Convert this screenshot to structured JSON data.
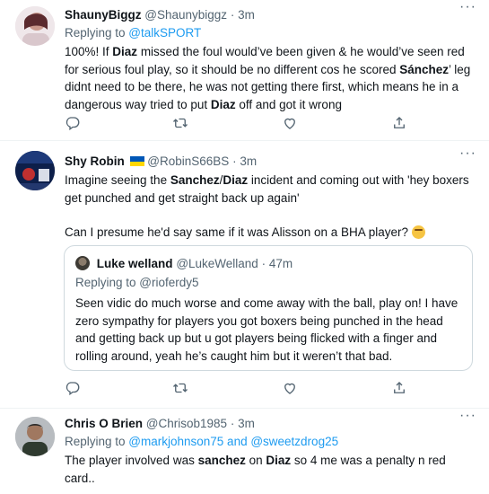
{
  "tweets": [
    {
      "name": "ShaunyBiggz",
      "handle": "@Shaunybiggz",
      "time": "3m",
      "replying_prefix": "Replying to ",
      "replying_to": "@talkSPORT",
      "text": [
        [
          "100%! If ",
          {
            "b": "Diaz"
          },
          " missed the foul would’ve been given & he would’ve seen red for serious foul play, so it should be no different cos he scored ",
          {
            "b": "Sánchez"
          },
          "’ leg didnt need to be there, he was not getting there first, which means he in a dangerous way tried to put ",
          {
            "b": "Diaz"
          },
          " off and got it wrong"
        ]
      ]
    },
    {
      "name": "Shy Robin",
      "handle": "@RobinS66BS",
      "time": "3m",
      "text": [
        [
          "Imagine seeing the ",
          {
            "b": "Sanchez"
          },
          "/",
          {
            "b": "Diaz"
          },
          " incident and coming out with 'hey boxers get punched and get straight back up again'"
        ],
        [
          "Can I presume he'd say same if it was Alisson on a BHA player? "
        ]
      ],
      "quote": {
        "name": "Luke welland",
        "handle": "@LukeWelland",
        "time": "47m",
        "replying_prefix": "Replying to ",
        "replying_to": "@rioferdy5",
        "text": "Seen vidic do much worse and come away with the ball, play on! I have zero sympathy for players you got boxers being punched in the head and getting back up but u got players being flicked with a finger and rolling around, yeah he’s caught him but it weren’t that bad."
      }
    },
    {
      "name": "Chris O Brien",
      "handle": "@Chrisob1985",
      "time": "3m",
      "replying_prefix": "Replying to ",
      "replying_to": "@markjohnson75 and @sweetzdrog25",
      "text": [
        [
          "The player involved was ",
          {
            "b": "sanchez"
          },
          " on ",
          {
            "b": "Diaz"
          },
          " so 4 me was a penalty n red card.."
        ]
      ]
    }
  ],
  "dot_separator": "·",
  "more_glyph": "···",
  "icons": {
    "reply": "reply-icon",
    "retweet": "retweet-icon",
    "like": "like-icon",
    "share": "share-icon",
    "more": "more-icon",
    "flag": "ukraine-flag-icon",
    "emoji": "thinking-face-icon"
  },
  "colors": {
    "link": "#1d9bf0",
    "secondary": "#536471",
    "divider": "#eff3f4"
  }
}
